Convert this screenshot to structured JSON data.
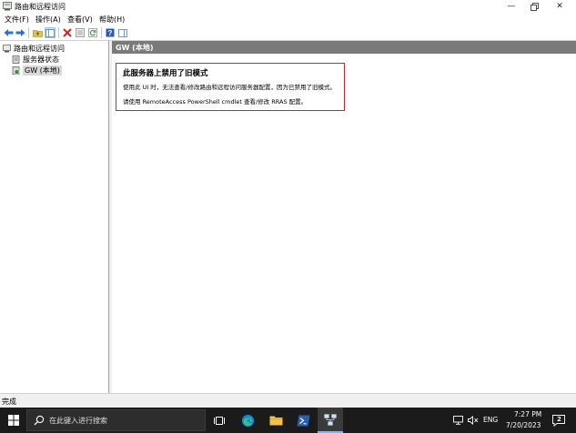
{
  "window": {
    "title": "路由和远程访问",
    "menu": [
      "文件(F)",
      "操作(A)",
      "查看(V)",
      "帮助(H)"
    ]
  },
  "tree": {
    "root": "路由和远程访问",
    "items": [
      "服务器状态",
      "GW (本地)"
    ]
  },
  "panel": {
    "header": "GW (本地)",
    "notice": {
      "heading": "此服务器上禁用了旧模式",
      "line1": "使用此 UI 时，无法查看/修改路由和远程访问服务器配置，因为已禁用了旧模式。",
      "line2": "请使用 RemoteAccess PowerShell cmdlet 查看/修改 RRAS 配置。"
    }
  },
  "status": {
    "text": "完成"
  },
  "taskbar": {
    "search_placeholder": "在此键入进行搜索",
    "lang": "ENG",
    "time": "7:27 PM",
    "date": "7/20/2023",
    "notification_count": "2"
  },
  "colors": {
    "accent_red": "#e02020",
    "panel_header": "#7a7a7a",
    "taskbar": "#1b1b1b"
  }
}
